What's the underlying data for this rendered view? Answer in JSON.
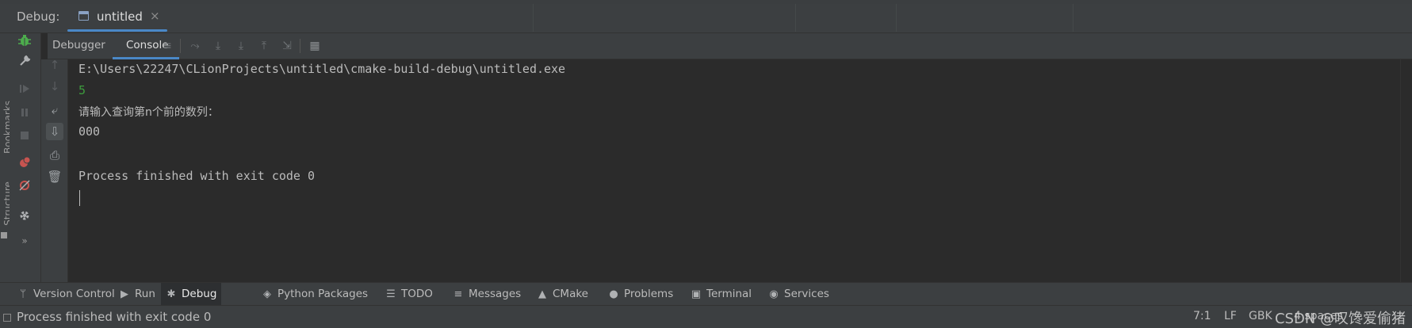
{
  "debug_bar": {
    "label": "Debug:",
    "tab_label": "untitled",
    "tab_close": "×"
  },
  "toolbar": {
    "tabs": [
      "Debugger",
      "Console"
    ],
    "active_tab": "Console"
  },
  "left_strip": {
    "bookmarks_label": "Bookmarks",
    "structure_label": "Structure",
    "more": "»"
  },
  "console": {
    "lines": [
      "E:\\Users\\22247\\CLionProjects\\untitled\\cmake-build-debug\\untitled.exe",
      "5",
      "请输入查询第n个前的数列：",
      "000",
      "",
      "Process finished with exit code 0"
    ]
  },
  "bottom_tools": [
    {
      "label": "Version Control",
      "icon": "branch-icon"
    },
    {
      "label": "Run",
      "icon": "play-icon"
    },
    {
      "label": "Debug",
      "icon": "bug-icon",
      "active": true
    },
    {
      "label": "Python Packages",
      "icon": "layers-icon"
    },
    {
      "label": "TODO",
      "icon": "list-icon"
    },
    {
      "label": "Messages",
      "icon": "messages-icon"
    },
    {
      "label": "CMake",
      "icon": "triangle-icon"
    },
    {
      "label": "Problems",
      "icon": "info-icon"
    },
    {
      "label": "Terminal",
      "icon": "terminal-icon"
    },
    {
      "label": "Services",
      "icon": "services-icon"
    }
  ],
  "status_bar": {
    "message": "Process finished with exit code 0",
    "position": "7:1",
    "line_ending": "LF",
    "encoding": "GBK",
    "indent": "4 spaces",
    "watermark": "CSDN @叹馋爱偷猪"
  },
  "colors": {
    "accent": "#4a88c7",
    "bug_green": "#4dad4d",
    "breakpoint_red": "#c75450",
    "input_green": "#3d9c3d"
  }
}
